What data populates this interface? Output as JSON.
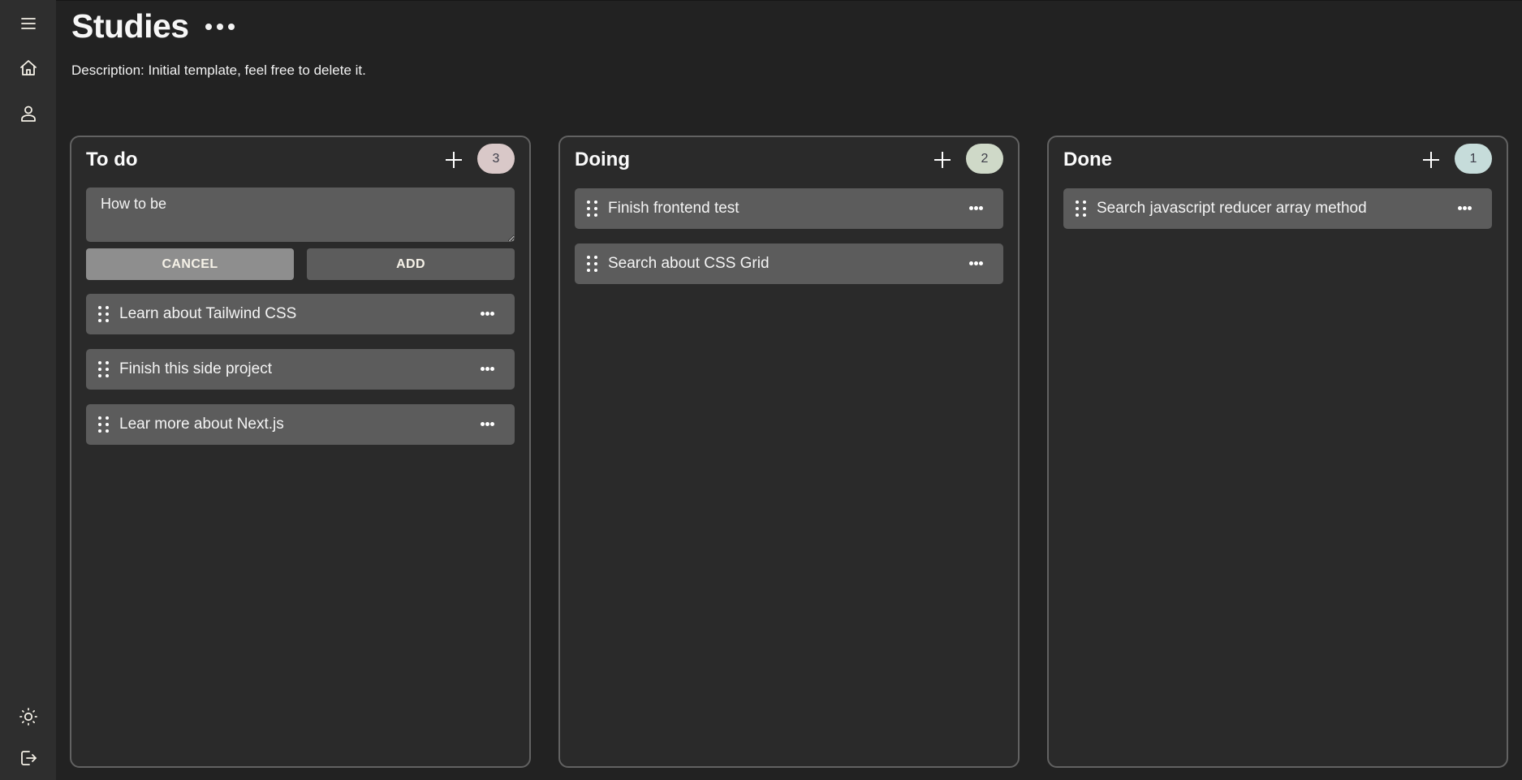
{
  "sidebar": {
    "top_icons": [
      "menu-icon",
      "home-icon",
      "user-icon"
    ],
    "bottom_icons": [
      "sun-icon",
      "logout-icon"
    ]
  },
  "board": {
    "title": "Studies",
    "menu_icon": "more-horizontal-icon",
    "description": "Description: Initial template, feel free to delete it."
  },
  "columns": [
    {
      "title": "To do",
      "count": "3",
      "badge_color": "#d9c8c8",
      "add_icon": "plus-icon",
      "add_form": {
        "value": "How to be",
        "cancel_label": "CANCEL",
        "add_label": "ADD"
      },
      "cards": [
        {
          "text": "Learn about Tailwind CSS"
        },
        {
          "text": "Finish this side project"
        },
        {
          "text": "Lear more about Next.js"
        }
      ]
    },
    {
      "title": "Doing",
      "count": "2",
      "badge_color": "#cfd9c8",
      "add_icon": "plus-icon",
      "cards": [
        {
          "text": "Finish frontend test"
        },
        {
          "text": "Search about CSS Grid"
        }
      ]
    },
    {
      "title": "Done",
      "count": "1",
      "badge_color": "#c6dcda",
      "add_icon": "plus-icon",
      "cards": [
        {
          "text": "Search javascript reducer array method"
        }
      ]
    }
  ]
}
